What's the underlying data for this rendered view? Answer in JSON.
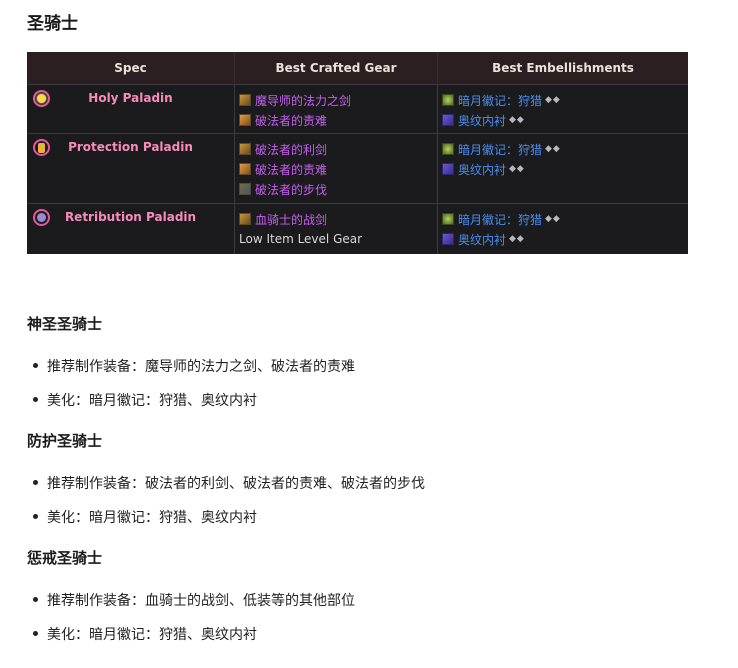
{
  "page_title": "圣骑士",
  "table": {
    "headers": {
      "spec": "Spec",
      "gear": "Best Crafted Gear",
      "embellishments": "Best Embellishments"
    },
    "rows": [
      {
        "spec": "Holy Paladin",
        "spec_icon": "holy-light-icon",
        "gear": [
          "魔导师的法力之剑",
          "破法者的责难"
        ],
        "embellishments": [
          "暗月徽记：狩猎",
          "奥纹内衬"
        ]
      },
      {
        "spec": "Protection Paladin",
        "spec_icon": "shield-icon",
        "gear": [
          "破法者的利剑",
          "破法者的责难",
          "破法者的步伐"
        ],
        "embellishments": [
          "暗月徽记：狩猎",
          "奥纹内衬"
        ]
      },
      {
        "spec": "Retribution Paladin",
        "spec_icon": "retribution-icon",
        "gear": [
          "血骑士的战剑",
          "Low Item Level Gear"
        ],
        "embellishments": [
          "暗月徽记：狩猎",
          "奥纹内衬"
        ]
      }
    ],
    "gem_marker": "◆◆"
  },
  "sections": [
    {
      "heading": "神圣圣骑士",
      "gear_line": "推荐制作装备：魔导师的法力之剑、破法者的责难",
      "emb_line": "美化：暗月徽记：狩猎、奥纹内衬"
    },
    {
      "heading": "防护圣骑士",
      "gear_line": "推荐制作装备：破法者的利剑、破法者的责难、破法者的步伐",
      "emb_line": "美化：暗月徽记：狩猎、奥纹内衬"
    },
    {
      "heading": "惩戒圣骑士",
      "gear_line": "推荐制作装备：血骑士的战剑、低装等的其他部位",
      "emb_line": "美化：暗月徽记：狩猎、奥纹内衬"
    }
  ],
  "colors": {
    "table_bg": "#1b1b1d",
    "header_bg": "#2c1f22",
    "spec_name": "#f58cba",
    "epic_item": "#c55ff0",
    "embellishment_link": "#4a8ef0"
  }
}
